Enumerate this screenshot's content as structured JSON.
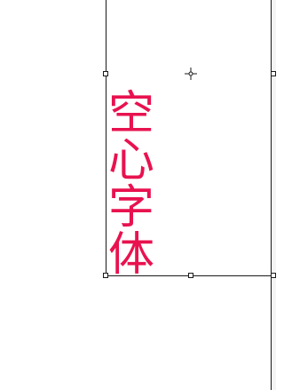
{
  "text_frame": {
    "characters": [
      "空",
      "心",
      "字",
      "体"
    ],
    "text_color": "#e8124f"
  },
  "icons": {
    "center_marker": "reference-point-icon"
  }
}
